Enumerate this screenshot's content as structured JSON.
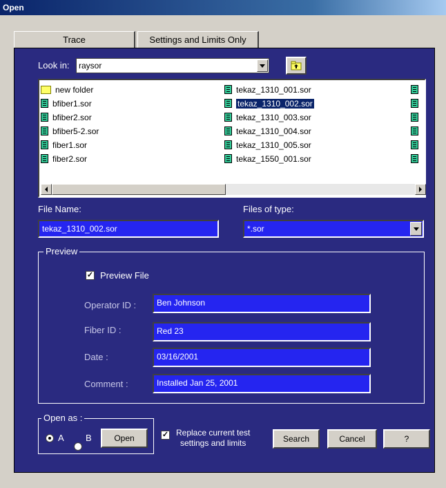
{
  "window": {
    "title": "Open"
  },
  "tabs": [
    {
      "label": "Trace",
      "active": true
    },
    {
      "label": "Settings and Limits Only",
      "active": false
    }
  ],
  "look_in": {
    "label": "Look in:",
    "value": "raysor"
  },
  "files": {
    "col1": [
      {
        "name": "new folder",
        "icon": "folder-icon"
      },
      {
        "name": "bfiber1.sor",
        "icon": "sor-file-icon"
      },
      {
        "name": "bfiber2.sor",
        "icon": "sor-file-icon"
      },
      {
        "name": "bfiber5-2.sor",
        "icon": "sor-file-icon"
      },
      {
        "name": "fiber1.sor",
        "icon": "sor-file-icon"
      },
      {
        "name": "fiber2.sor",
        "icon": "sor-file-icon"
      }
    ],
    "col2": [
      {
        "name": "tekaz_1310_001.sor",
        "selected": false
      },
      {
        "name": "tekaz_1310_002.sor",
        "selected": true
      },
      {
        "name": "tekaz_1310_003.sor",
        "selected": false
      },
      {
        "name": "tekaz_1310_004.sor",
        "selected": false
      },
      {
        "name": "tekaz_1310_005.sor",
        "selected": false
      },
      {
        "name": "tekaz_1550_001.sor",
        "selected": false
      }
    ]
  },
  "file_name": {
    "label": "File Name:",
    "value": "tekaz_1310_002.sor"
  },
  "files_of_type": {
    "label": "Files of type:",
    "value": "*.sor"
  },
  "preview": {
    "group_label": "Preview",
    "checkbox_label": "Preview File",
    "checked": true,
    "operator_id": {
      "label": "Operator ID :",
      "value": "Ben Johnson"
    },
    "fiber_id": {
      "label": "Fiber ID :",
      "value": "Red 23"
    },
    "date": {
      "label": "Date :",
      "value": "03/16/2001"
    },
    "comment": {
      "label": "Comment :",
      "value": "Installed Jan 25, 2001"
    }
  },
  "open_as": {
    "group_label": "Open as :",
    "option_a": "A",
    "option_b": "B",
    "selected": "A",
    "open_button": "Open"
  },
  "replace_settings": {
    "label_line1": "Replace current test",
    "label_line2": "settings and limits",
    "checked": true
  },
  "buttons": {
    "search": "Search",
    "cancel": "Cancel",
    "help": "?"
  },
  "colors": {
    "panel": "#2a2a80",
    "field": "#2525f0",
    "selection": "#0a246a",
    "sor_icon": "#33cc99"
  }
}
